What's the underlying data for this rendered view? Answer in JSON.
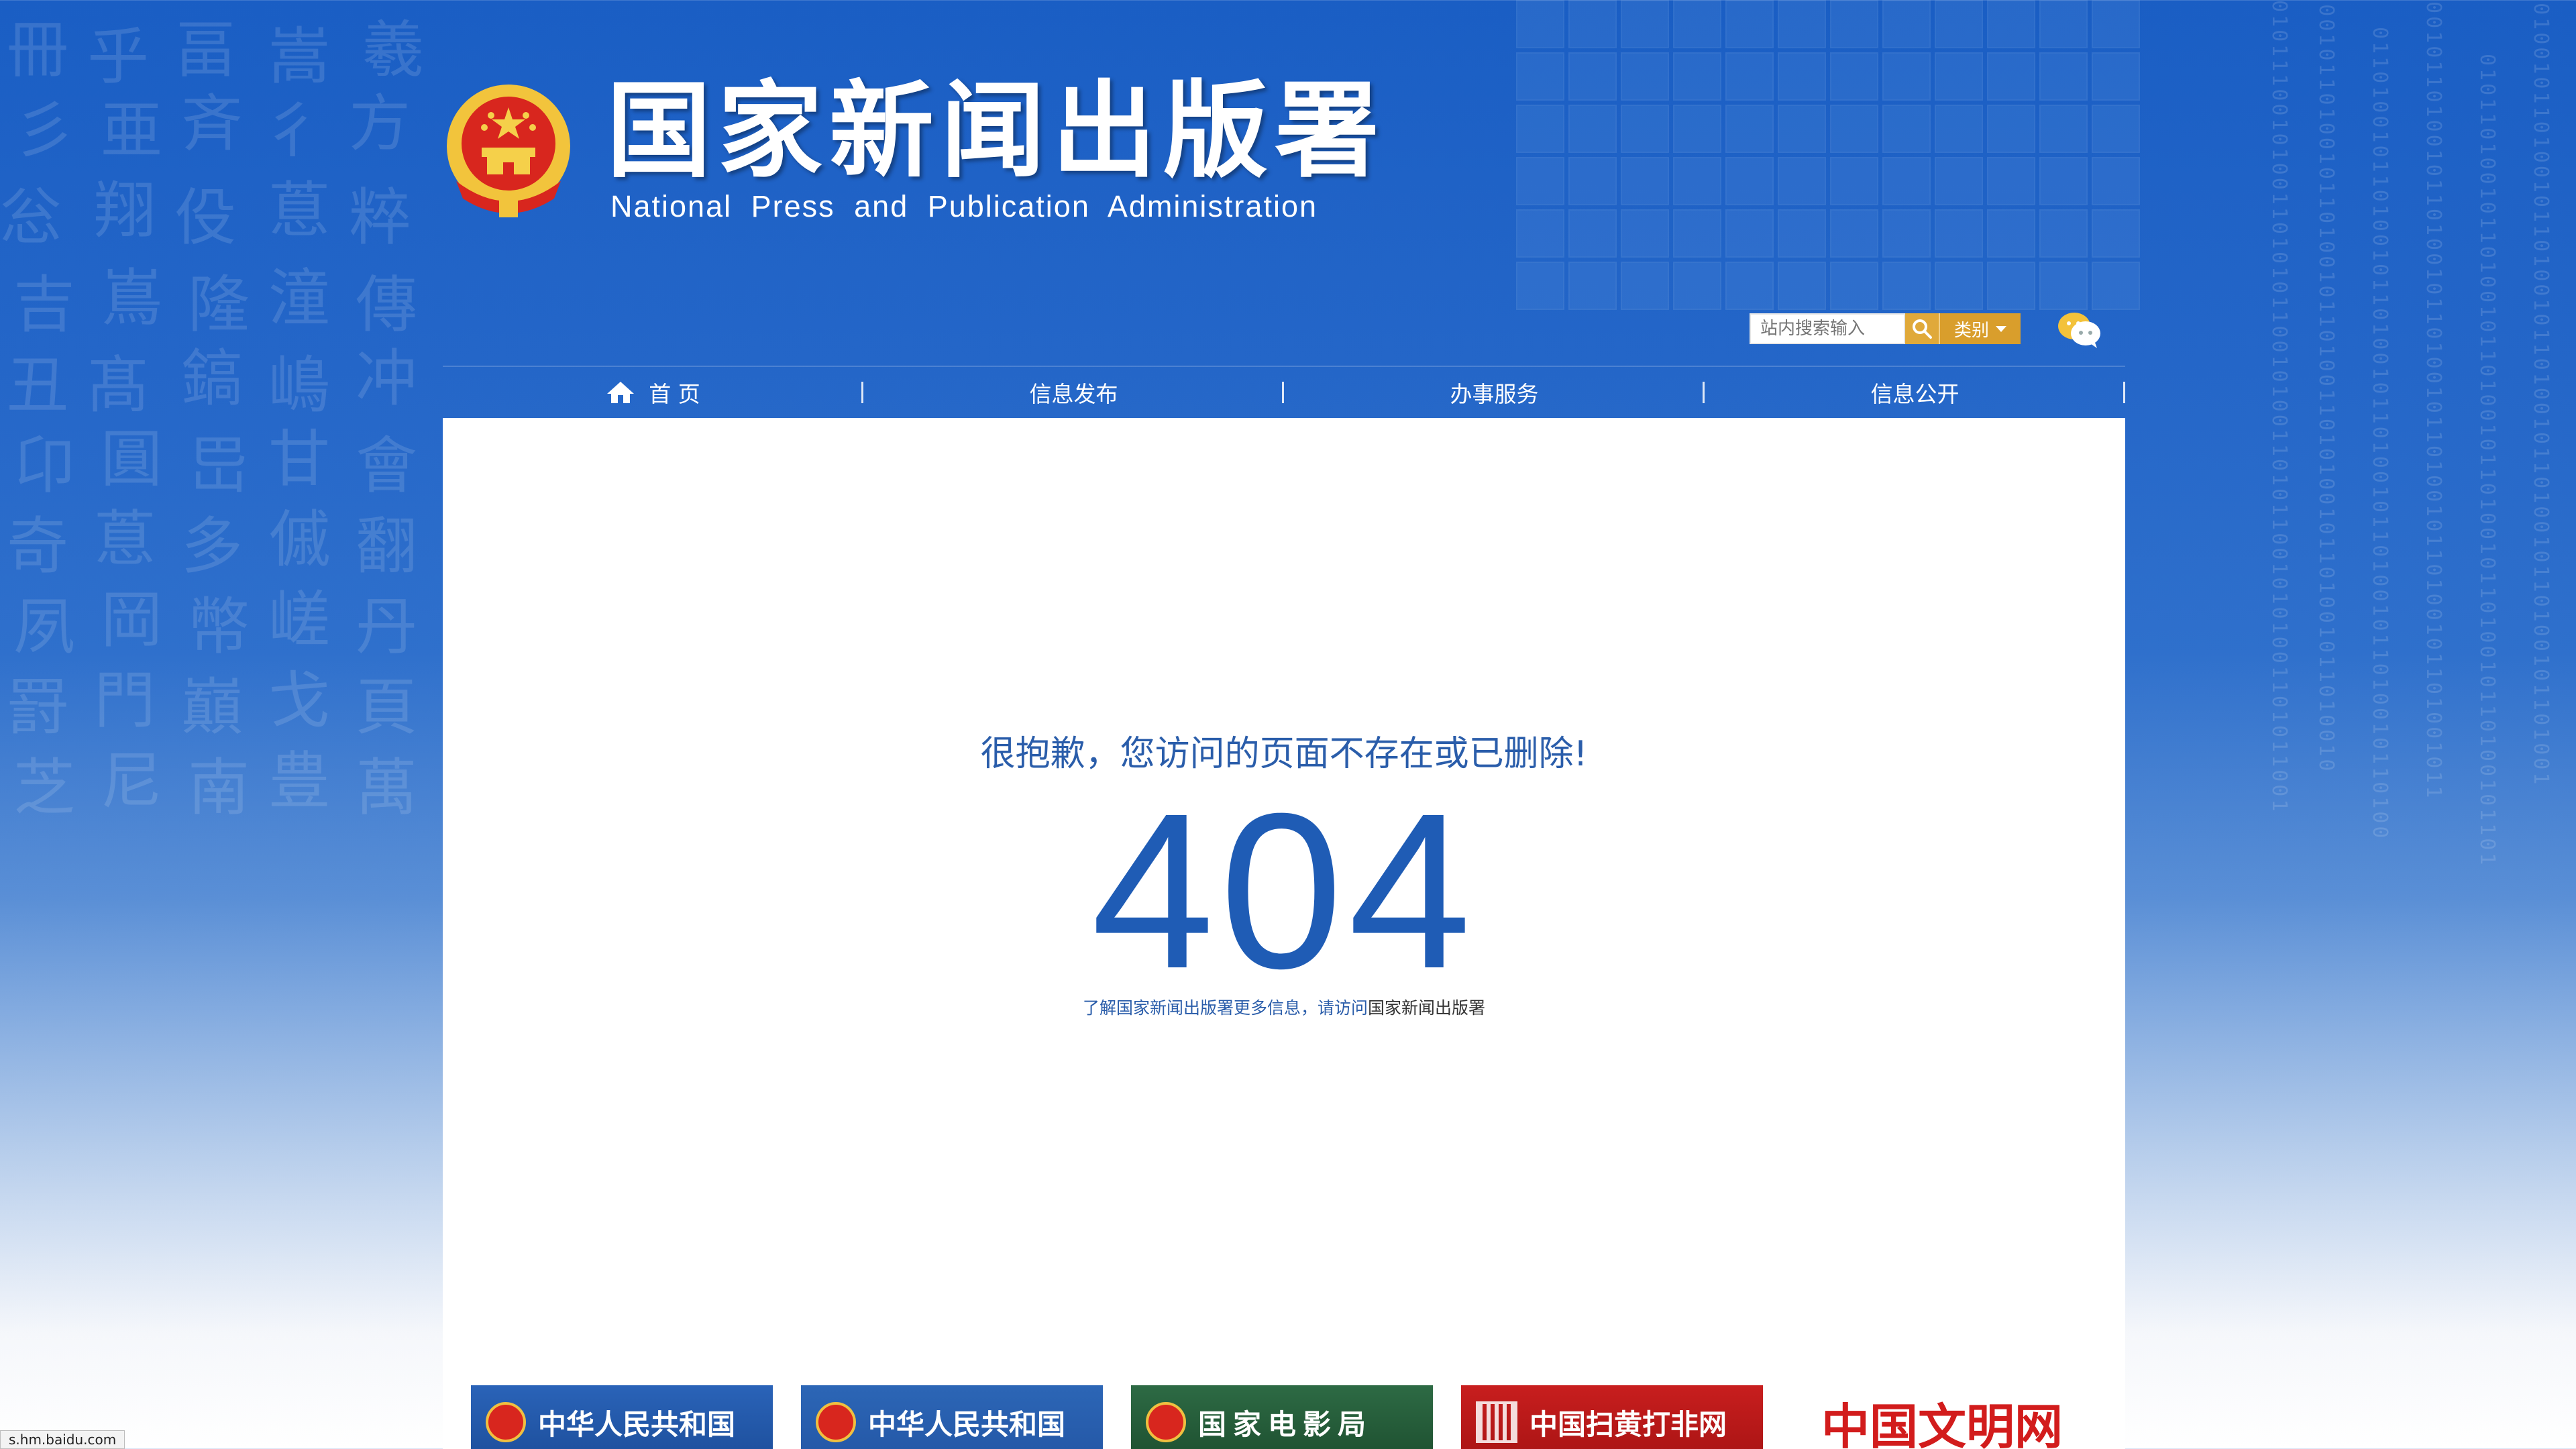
{
  "header": {
    "title_cn": "国家新闻出版署",
    "title_en": "National  Press and Publication Administration",
    "emblem_icon": "national-emblem-icon"
  },
  "search": {
    "placeholder": "站内搜索输入",
    "category_label": "类别",
    "search_icon": "search-icon",
    "wechat_icon": "wechat-icon"
  },
  "nav": {
    "items": [
      {
        "label": "首 页",
        "icon": "home-icon"
      },
      {
        "label": "信息发布"
      },
      {
        "label": "办事服务"
      },
      {
        "label": "信息公开"
      }
    ]
  },
  "error": {
    "message": "很抱歉，您访问的页面不存在或已删除!",
    "code": "404",
    "more_info_prefix": "了解国家新闻出版署更多信息，请访问",
    "more_info_link": "国家新闻出版署"
  },
  "banners": [
    {
      "label": "中华人民共和国"
    },
    {
      "label": "中华人民共和国"
    },
    {
      "label": "国家电影局"
    },
    {
      "label": "中国扫黄打非网"
    },
    {
      "label": "中国文明网"
    }
  ],
  "status_bar": {
    "text": "s.hm.baidu.com"
  },
  "colors": {
    "brand_blue": "#1f5cb5",
    "search_gold": "#d99e2c",
    "banner_red": "#c81e1e"
  }
}
